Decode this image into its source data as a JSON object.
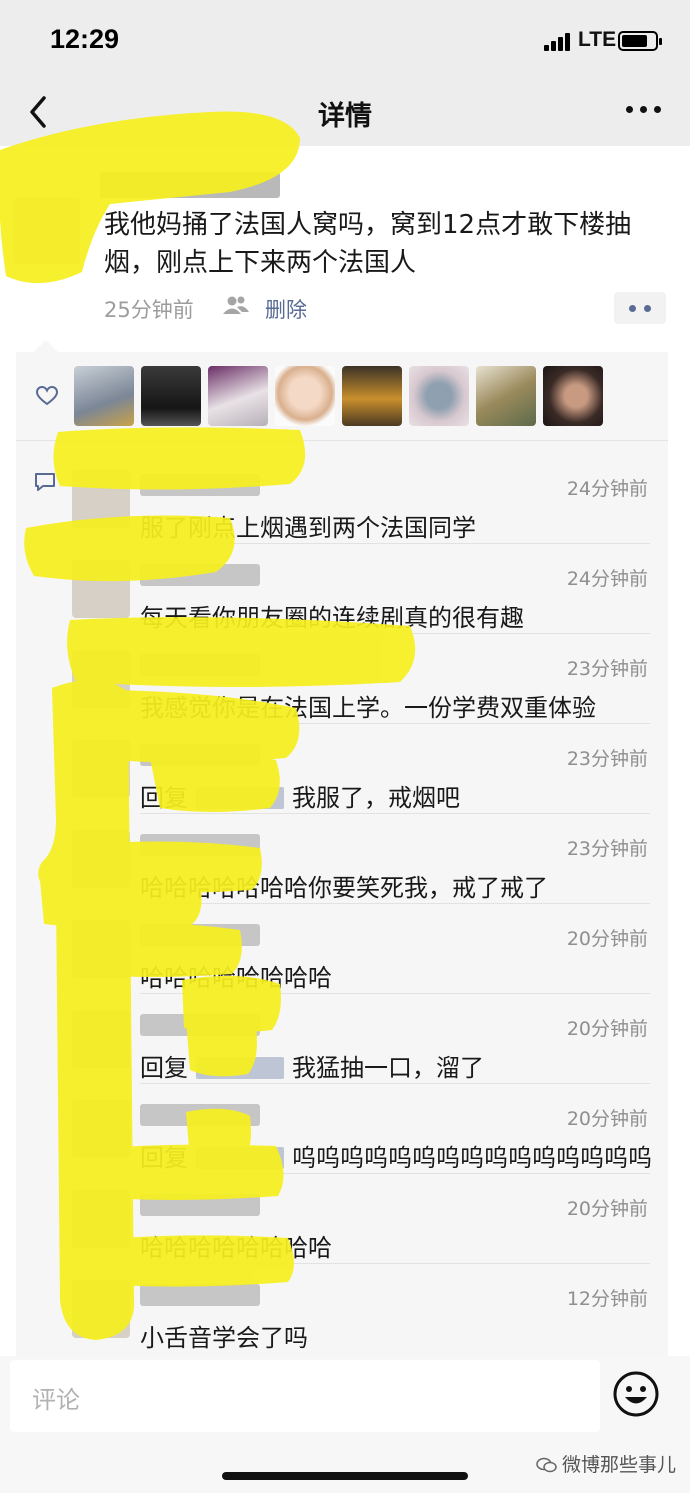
{
  "status_bar": {
    "time": "12:29",
    "network": "LTE",
    "battery_level": 0.78
  },
  "nav": {
    "title": "详情",
    "back_icon": "chevron-left-icon",
    "more_icon": "ellipsis-icon"
  },
  "post": {
    "text": "我他妈捅了法国人窝吗，窝到12点才敢下楼抽烟，刚点上下来两个法国人",
    "time": "25分钟前",
    "visibility_icon": "friends-icon",
    "delete_label": "删除"
  },
  "likes": {
    "icon": "heart-icon",
    "count": 8
  },
  "comments": [
    {
      "time": "24分钟前",
      "text": "服了刚点上烟遇到两个法国同学",
      "is_reply": false
    },
    {
      "time": "24分钟前",
      "text": "每天看你朋友圈的连续剧真的很有趣",
      "is_reply": false
    },
    {
      "time": "23分钟前",
      "text": "我感觉你是在法国上学。一份学费双重体验",
      "is_reply": false
    },
    {
      "time": "23分钟前",
      "reply_prefix": "回复",
      "text": "我服了，戒烟吧",
      "is_reply": true
    },
    {
      "time": "23分钟前",
      "text": "哈哈哈哈哈哈哈你要笑死我，戒了戒了",
      "is_reply": false
    },
    {
      "time": "20分钟前",
      "text": "哈哈哈哈哈哈哈哈",
      "is_reply": false
    },
    {
      "time": "20分钟前",
      "reply_prefix": "回复",
      "text": "我猛抽一口，溜了",
      "is_reply": true
    },
    {
      "time": "20分钟前",
      "reply_prefix": "回复",
      "text": "呜呜呜呜呜呜呜呜呜呜呜呜呜呜呜",
      "is_reply": true
    },
    {
      "time": "20分钟前",
      "text": "哈哈哈哈哈哈哈哈",
      "is_reply": false
    },
    {
      "time": "12分钟前",
      "text": "小舌音学会了吗",
      "is_reply": false
    }
  ],
  "comment_bar": {
    "placeholder": "评论",
    "emoji_icon": "smiley-icon"
  },
  "watermark": {
    "text": "微博那些事儿",
    "icon": "wechat-logo-icon"
  },
  "colors": {
    "link": "#576b95",
    "highlighter": "#f6ef1f",
    "background": "#ededed"
  }
}
